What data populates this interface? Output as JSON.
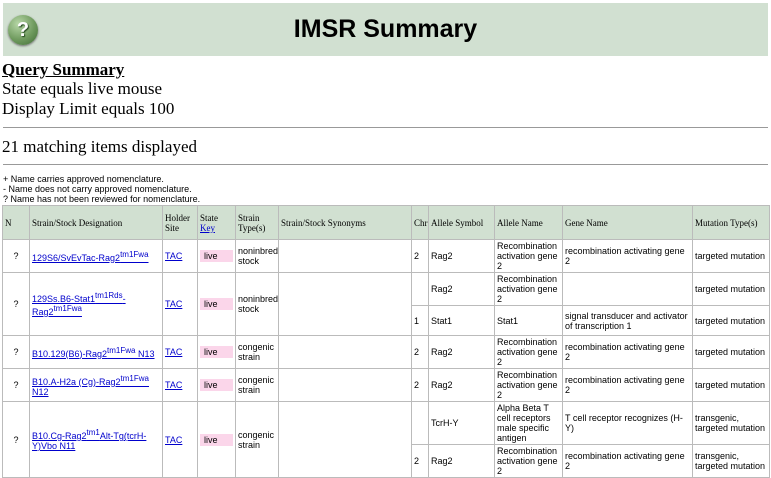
{
  "header": {
    "title": "IMSR Summary",
    "help_label": "?"
  },
  "query": {
    "title": "Query Summary",
    "line1": "State equals live mouse",
    "line2": "Display Limit equals 100"
  },
  "count_text": "21 matching items displayed",
  "legend": [
    "+  Name carries approved nomenclature.",
    "-  Name does not carry approved nomenclature.",
    "?  Name has not been reviewed for nomenclature."
  ],
  "columns": {
    "n": "N",
    "strain": "Strain/Stock Designation",
    "holder": "Holder Site",
    "state": "State",
    "key": "Key",
    "type": "Strain Type(s)",
    "synonyms": "Strain/Stock Synonyms",
    "chr": "Chr",
    "allele_symbol": "Allele Symbol",
    "allele_name": "Allele Name",
    "gene_name": "Gene Name",
    "mutation": "Mutation Type(s)"
  },
  "rows": [
    {
      "n": "?",
      "strain": [
        [
          "129S6/SvEvTac-Rag2",
          ""
        ],
        [
          "tm1Fwa",
          "sup"
        ]
      ],
      "holder": "TAC",
      "state": "live",
      "type": "noninbred stock",
      "alleles": [
        {
          "chr": "2",
          "symbol": "Rag2",
          "name": "Recombination activation gene 2",
          "gene": "recombination activating gene 2",
          "mutation": "targeted mutation"
        }
      ]
    },
    {
      "n": "?",
      "strain": [
        [
          "129Ss.B6-Stat1",
          ""
        ],
        [
          "tm1Rds",
          "sup"
        ],
        [
          "-Rag2",
          ""
        ],
        [
          "tm1Fwa",
          "sup"
        ]
      ],
      "holder": "TAC",
      "state": "live",
      "type": "noninbred stock",
      "alleles": [
        {
          "chr": "",
          "symbol": "Rag2",
          "name": "Recombination activation gene 2",
          "gene": "",
          "mutation": "targeted mutation"
        },
        {
          "chr": "1",
          "symbol": "Stat1",
          "name": "Stat1",
          "gene": "signal transducer and activator of transcription 1",
          "mutation": "targeted mutation"
        }
      ]
    },
    {
      "n": "?",
      "strain": [
        [
          "B10.129(B6)-Rag2",
          ""
        ],
        [
          "tm1Fwa",
          "sup"
        ],
        [
          " N13",
          ""
        ]
      ],
      "holder": "TAC",
      "state": "live",
      "type": "congenic strain",
      "alleles": [
        {
          "chr": "2",
          "symbol": "Rag2",
          "name": "Recombination activation gene 2",
          "gene": "recombination activating gene 2",
          "mutation": "targeted mutation"
        }
      ]
    },
    {
      "n": "?",
      "strain": [
        [
          "B10.A-H2a (Cg)-Rag2",
          ""
        ],
        [
          "tm1Fwa",
          "sup"
        ],
        [
          " N12",
          ""
        ]
      ],
      "holder": "TAC",
      "state": "live",
      "type": "congenic strain",
      "alleles": [
        {
          "chr": "2",
          "symbol": "Rag2",
          "name": "Recombination activation gene 2",
          "gene": "recombination activating gene 2",
          "mutation": "targeted mutation"
        }
      ]
    },
    {
      "n": "?",
      "strain": [
        [
          "B10.Cg-Rag2",
          ""
        ],
        [
          "tm1",
          "sup"
        ],
        [
          "Alt-Tg(tcrH-Y)Vbo N11",
          ""
        ]
      ],
      "holder": "TAC",
      "state": "live",
      "type": "congenic strain",
      "alleles": [
        {
          "chr": "",
          "symbol": "TcrH-Y",
          "name": "Alpha Beta T cell receptors male specific antigen",
          "gene": "T cell receptor recognizes (H-Y)",
          "mutation": "transgenic, targeted mutation"
        },
        {
          "chr": "2",
          "symbol": "Rag2",
          "name": "Recombination activation gene 2",
          "gene": "recombination activating gene 2",
          "mutation": "transgenic, targeted mutation"
        }
      ]
    }
  ]
}
